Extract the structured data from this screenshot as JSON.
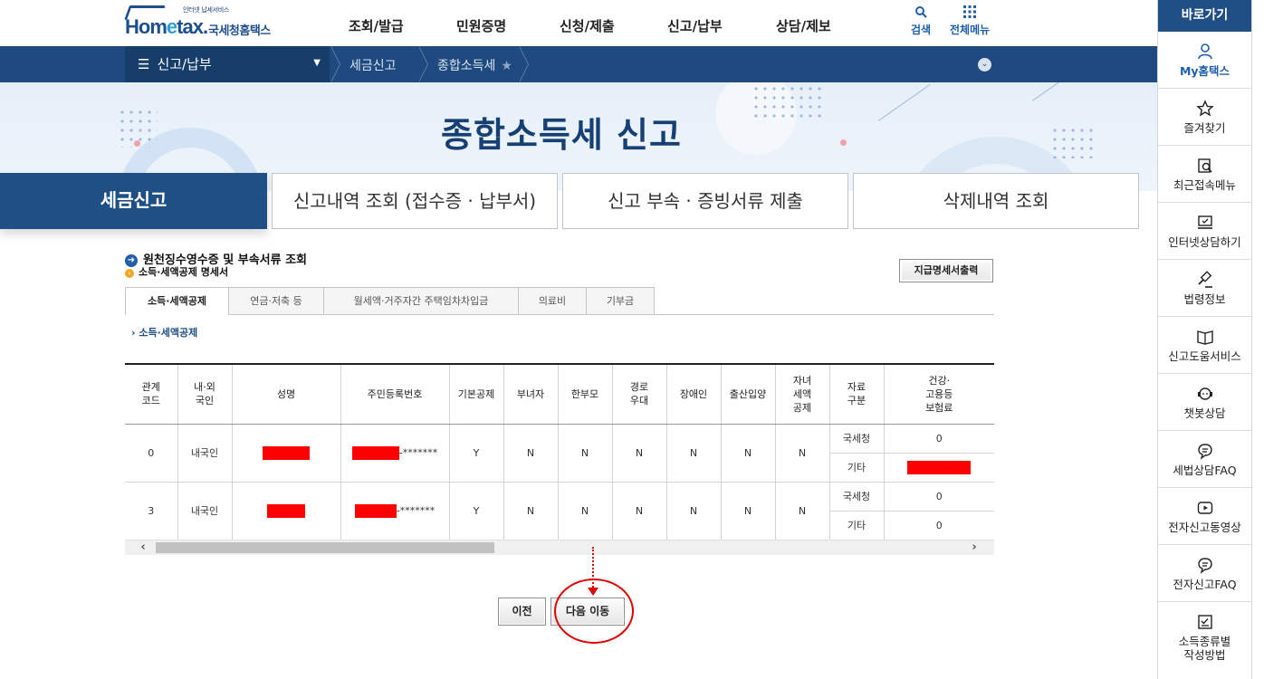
{
  "header": {
    "logo": {
      "tagline": "인터넷 납세서비스",
      "brand_home": "Hom",
      "brand_e": "e",
      "brand_tax": "tax.",
      "brand_kor": "국세청홈택스"
    },
    "gnb": [
      "조회/발급",
      "민원증명",
      "신청/제출",
      "신고/납부",
      "상담/제보"
    ],
    "search_label": "검색",
    "all_menu_label": "전체메뉴"
  },
  "navbar": {
    "selected_menu": "신고/납부",
    "breadcrumb": [
      "세금신고",
      "종합소득세"
    ]
  },
  "hero": {
    "title": "종합소득세  신고"
  },
  "main_tabs": [
    {
      "label": "세금신고",
      "active": true
    },
    {
      "label": "신고내역 조회 (접수증 · 납부서)",
      "active": false
    },
    {
      "label": "신고 부속 · 증빙서류 제출",
      "active": false
    },
    {
      "label": "삭제내역 조회",
      "active": false
    }
  ],
  "content": {
    "section_title": "원천징수영수증 및 부속서류 조회",
    "sub_title": "소득·세액공제 명세서",
    "print_button": "지급명세서출력",
    "sub_tabs": [
      {
        "label": "소득·세액공제",
        "active": true
      },
      {
        "label": "연금·저축 등",
        "active": false
      },
      {
        "label": "월세액·거주자간 주택임차차입금",
        "active": false
      },
      {
        "label": "의료비",
        "active": false
      },
      {
        "label": "기부금",
        "active": false
      }
    ],
    "inner_crumb": "소득·세액공제"
  },
  "table": {
    "headers": [
      "관계\n코드",
      "내·외\n국인",
      "성명",
      "주민등록번호",
      "기본공제",
      "부녀자",
      "한부모",
      "경로\n우대",
      "장애인",
      "출산입양",
      "자녀\n세액\n공제",
      "자료\n구분",
      "건강·\n고용등\n보험료"
    ],
    "rows": [
      {
        "code": "0",
        "nation": "내국인",
        "name": "",
        "rrn_suffix": "-*******",
        "basic": "Y",
        "women": "N",
        "single": "N",
        "elder": "N",
        "disabled": "N",
        "birth": "N",
        "child": "N",
        "sources": [
          {
            "label": "국세청",
            "insurance": "0"
          },
          {
            "label": "기타",
            "insurance": ""
          }
        ]
      },
      {
        "code": "3",
        "nation": "내국인",
        "name": "",
        "rrn_suffix": "-*******",
        "basic": "Y",
        "women": "N",
        "single": "N",
        "elder": "N",
        "disabled": "N",
        "birth": "N",
        "child": "N",
        "sources": [
          {
            "label": "국세청",
            "insurance": "0"
          },
          {
            "label": "기타",
            "insurance": "0"
          }
        ]
      }
    ]
  },
  "buttons": {
    "prev": "이전",
    "next": "다음 이동"
  },
  "quickbar": {
    "title": "바로가기",
    "items": [
      "My홈택스",
      "즐겨찾기",
      "최근접속메뉴",
      "인터넷상담하기",
      "법령정보",
      "신고도움서비스",
      "챗봇상담",
      "세법상담FAQ",
      "전자신고동영상",
      "전자신고FAQ",
      "소득종류별\n작성방법"
    ]
  },
  "colors": {
    "navy": "#1f4f85",
    "highlight_red": "#e00000",
    "redaction": "#ff0000"
  }
}
